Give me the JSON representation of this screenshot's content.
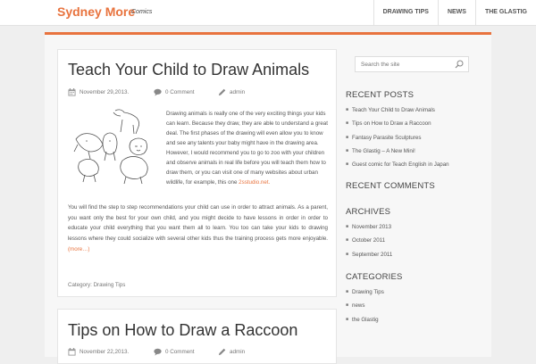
{
  "site": {
    "title": "Sydney More",
    "description": "Comics"
  },
  "nav": [
    "DRAWING TIPS",
    "NEWS",
    "THE GLASTIG"
  ],
  "colors": {
    "accent": "#e8733e"
  },
  "posts": [
    {
      "title": "Teach Your Child to Draw Animals",
      "date": "November 29,2013.",
      "comments": "0 Comment",
      "author": "admin",
      "excerpt": "Drawing animals is really one of the very exciting things your kids can learn. Because they draw, they are able to understand a great deal. The first phases of the drawing will even allow you to know and see any talents your baby might have in the drawing area. However, I would recommend you to go to zoo with your children and observe animals in real life before you will teach them how to draw them, or you can visit one of many websites about urban wildlife, for example, this one ",
      "excerpt_link": "2sstudio.net.",
      "body": "You will find the step to step recommendations your child can use in order to attract animals. As a parent, you want only the best for your own child, and you might decide to have lessons in order in order to educate your child everything that you want them all to learn. You too can take your kids to drawing lessons where they could socialize with several other kids thus the training process gets more enjoyable.",
      "more": "(more…)",
      "category_label": "Category:",
      "category": "Drawing Tips"
    },
    {
      "title": "Tips on How to Draw a Raccoon",
      "date": "November 22,2013.",
      "comments": "0 Comment",
      "author": "admin"
    }
  ],
  "sidebar": {
    "search_placeholder": "Search the site",
    "recent_posts_title": "RECENT POSTS",
    "recent_posts": [
      "Teach Your Child to Draw Animals",
      "Tips on How to Draw a Raccoon",
      "Fantasy Parasite Sculptures",
      "The Glastig – A New Mini!",
      "Guest comic for Teach English in Japan"
    ],
    "recent_comments_title": "RECENT COMMENTS",
    "archives_title": "ARCHIVES",
    "archives": [
      "November 2013",
      "October 2011",
      "September 2011"
    ],
    "categories_title": "CATEGORIES",
    "categories": [
      "Drawing Tips",
      "news",
      "the Glastig"
    ]
  }
}
